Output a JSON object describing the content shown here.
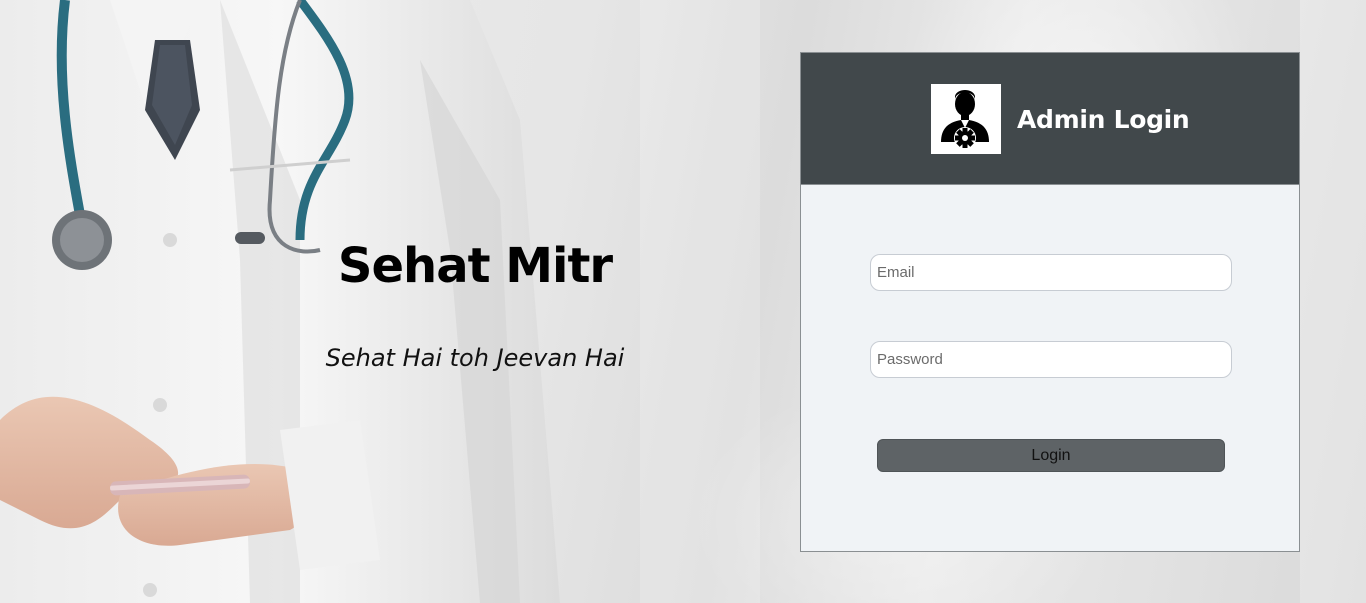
{
  "hero": {
    "title": "Sehat Mitr",
    "subtitle": "Sehat Hai toh Jeevan Hai"
  },
  "login": {
    "title": "Admin Login",
    "avatar_icon": "admin-gear-icon",
    "email": {
      "value": "",
      "placeholder": "Email"
    },
    "password": {
      "value": "",
      "placeholder": "Password"
    },
    "submit_label": "Login"
  },
  "colors": {
    "header_bg": "#41484b",
    "card_bg": "#f0f3f6",
    "button_bg": "#5e6366"
  }
}
